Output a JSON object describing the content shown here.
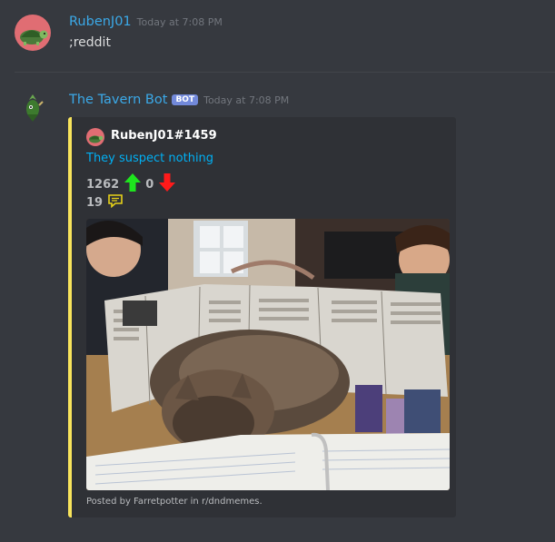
{
  "message1": {
    "username": "RubenJ01",
    "timestamp": "Today at 7:08 PM",
    "text": ";reddit",
    "name_color": "#43b581"
  },
  "message2": {
    "username": "The Tavern Bot",
    "bot_tag": "BOT",
    "timestamp": "Today at 7:08 PM",
    "name_color": "#3ba9e8"
  },
  "embed": {
    "accent_color": "#f8e45c",
    "author": "RubenJ01#1459",
    "title": "They suspect nothing",
    "upvotes": "1262",
    "downvotes": "0",
    "comments": "19",
    "footer": "Posted by Farretpotter in r/dndmemes."
  },
  "icons": [
    "turtle-avatar-icon",
    "tavern-bot-avatar-icon",
    "upvote-arrow-icon",
    "downvote-arrow-icon",
    "comment-icon"
  ]
}
